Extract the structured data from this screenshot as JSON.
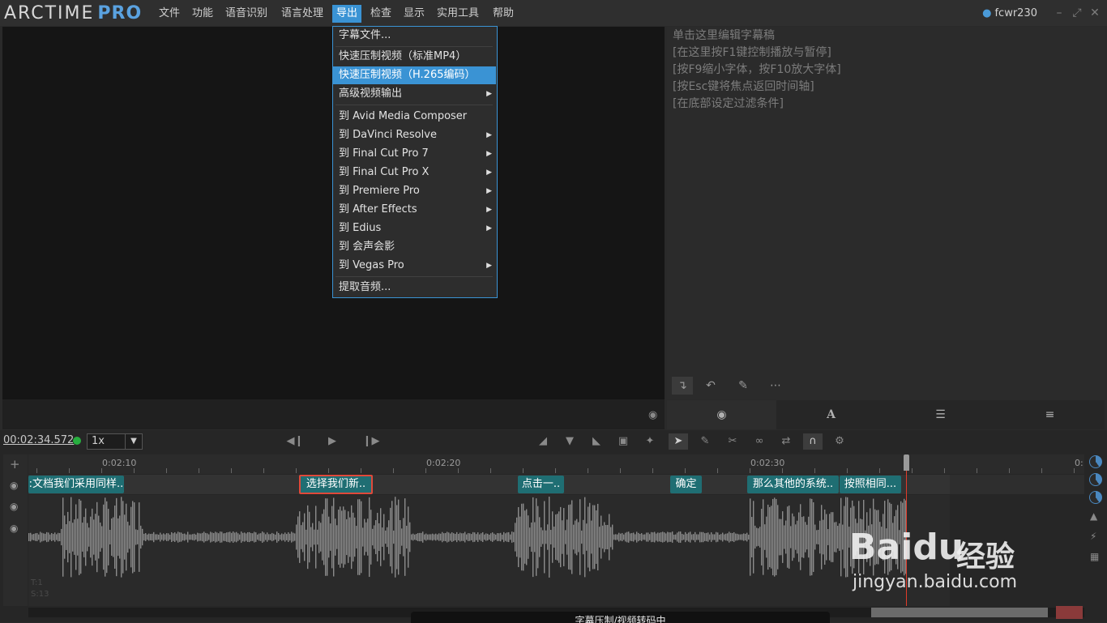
{
  "app": {
    "logo_main": "ARCTIME",
    "logo_pro": "PRO",
    "user": "fcwr230"
  },
  "menu": [
    "文件",
    "功能",
    "语音识别",
    "语言处理",
    "导出",
    "检查",
    "显示",
    "实用工具",
    "帮助"
  ],
  "export_menu": {
    "items": [
      {
        "label": "字幕文件...",
        "submenu": false
      },
      {
        "label": "快速压制视频（标准MP4）",
        "submenu": false
      },
      {
        "label": "快速压制视频（H.265编码）",
        "submenu": false,
        "highlighted": true
      },
      {
        "label": "高级视频输出",
        "submenu": true
      },
      {
        "label": "到 Avid Media Composer",
        "submenu": false
      },
      {
        "label": "到 DaVinci Resolve",
        "submenu": true
      },
      {
        "label": "到 Final Cut Pro 7",
        "submenu": true
      },
      {
        "label": "到 Final Cut Pro X",
        "submenu": true
      },
      {
        "label": "到 Premiere Pro",
        "submenu": true
      },
      {
        "label": "到 After Effects",
        "submenu": true
      },
      {
        "label": "到 Edius",
        "submenu": true
      },
      {
        "label": "到 会声会影",
        "submenu": false
      },
      {
        "label": "到 Vegas Pro",
        "submenu": true
      },
      {
        "label": "提取音频...",
        "submenu": false
      }
    ]
  },
  "script": {
    "lines": [
      "单击这里编辑字幕稿",
      "[在这里按F1键控制播放与暂停]",
      "[按F9缩小字体，按F10放大字体]",
      "[按Esc键将焦点返回时间轴]",
      "[在底部设定过滤条件]"
    ]
  },
  "transport": {
    "timecode": "00:02:34.572",
    "speed": "1x"
  },
  "timeline": {
    "ruler_labels": [
      "0:02:10",
      "0:02:20",
      "0:02:30",
      "0:"
    ],
    "clips": [
      {
        "text": ":文档我们采用同样..",
        "selected": false
      },
      {
        "text": "选择我们新..",
        "selected": true
      },
      {
        "text": "点击一..",
        "selected": false
      },
      {
        "text": "确定",
        "selected": false
      },
      {
        "text": "那么其他的系统..",
        "selected": false
      },
      {
        "text": "按照相同...",
        "selected": false
      }
    ],
    "wave_info": [
      "T:1",
      "S:13"
    ]
  },
  "status_popup": "字幕压制/视频转码中",
  "watermark": {
    "brand": "Bai",
    "brand2": "du",
    "cn": "经验",
    "url": "jingyan.baidu.com"
  },
  "colors": {
    "accent": "#3a93d4",
    "clip": "#1f6e73",
    "playhead": "#e23b2a",
    "status_ok": "#27ae3f"
  }
}
